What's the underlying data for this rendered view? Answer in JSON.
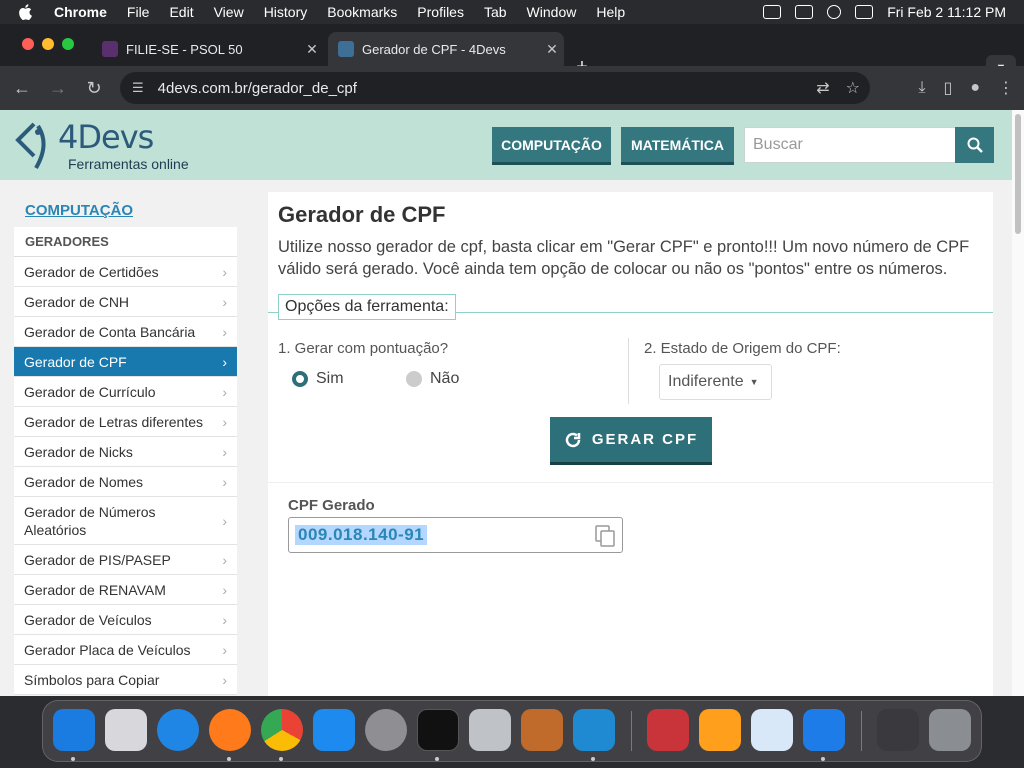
{
  "menubar": {
    "app": "Chrome",
    "items": [
      "File",
      "Edit",
      "View",
      "History",
      "Bookmarks",
      "Profiles",
      "Tab",
      "Window",
      "Help"
    ],
    "clock": "Fri Feb 2  11:12 PM"
  },
  "tabs": [
    {
      "title": "FILIE-SE - PSOL 50",
      "active": false
    },
    {
      "title": "Gerador de CPF - 4Devs",
      "active": true
    }
  ],
  "address": {
    "url": "4devs.com.br/gerador_de_cpf"
  },
  "site": {
    "logo_name": "4Devs",
    "logo_tagline": "Ferramentas online",
    "nav": [
      "COMPUTAÇÃO",
      "MATEMÁTICA"
    ],
    "search_placeholder": "Buscar"
  },
  "sidebar": {
    "heading": "COMPUTAÇÃO",
    "section": "GERADORES",
    "items": [
      "Gerador de Certidões",
      "Gerador de CNH",
      "Gerador de Conta Bancária",
      "Gerador de CPF",
      "Gerador de Currículo",
      "Gerador de Letras diferentes",
      "Gerador de Nicks",
      "Gerador de Nomes",
      "Gerador de Números Aleatórios",
      "Gerador de PIS/PASEP",
      "Gerador de RENAVAM",
      "Gerador de Veículos",
      "Gerador Placa de Veículos",
      "Símbolos para Copiar"
    ],
    "active_item": "Gerador de CPF"
  },
  "main": {
    "title": "Gerador de CPF",
    "intro": "Utilize nosso gerador de cpf, basta clicar em \"Gerar CPF\" e pronto!!! Um novo número de CPF válido será gerado. Você ainda tem opção de colocar ou não os \"pontos\" entre os números.",
    "options_legend": "Opções da ferramenta:",
    "q1_label": "1. Gerar com pontuação?",
    "radio_yes": "Sim",
    "radio_no": "Não",
    "q2_label": "2. Estado de Origem do CPF:",
    "state_selected": "Indiferente",
    "generate_button": "GERAR CPF",
    "result_label": "CPF Gerado",
    "result_value": "009.018.140-91"
  },
  "colors": {
    "header_bg": "#bfe1d6",
    "brand_teal": "#35777f",
    "sidebar_active": "#1779ad",
    "link_blue": "#2a86b5"
  }
}
